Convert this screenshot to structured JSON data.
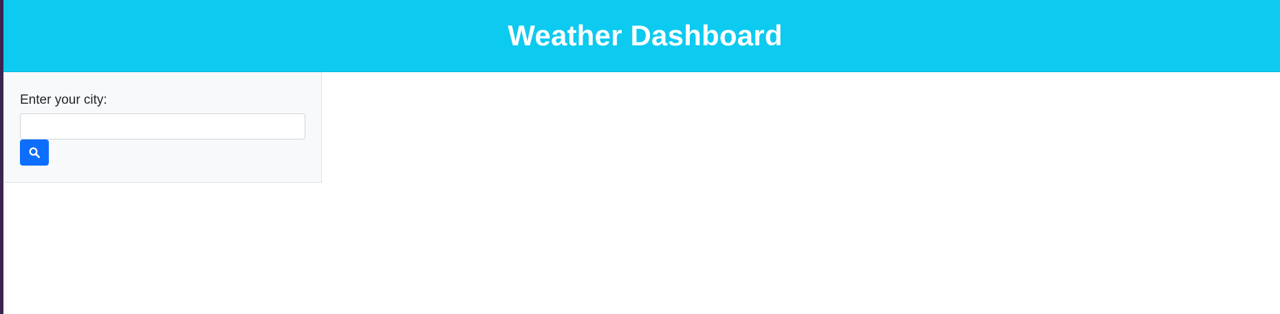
{
  "header": {
    "title": "Weather Dashboard",
    "background_color": "#0dcaf0",
    "text_color": "#ffffff"
  },
  "search": {
    "label": "Enter your city:",
    "input_value": "",
    "placeholder": "",
    "button_icon": "search-icon",
    "button_color": "#0d6efd"
  }
}
